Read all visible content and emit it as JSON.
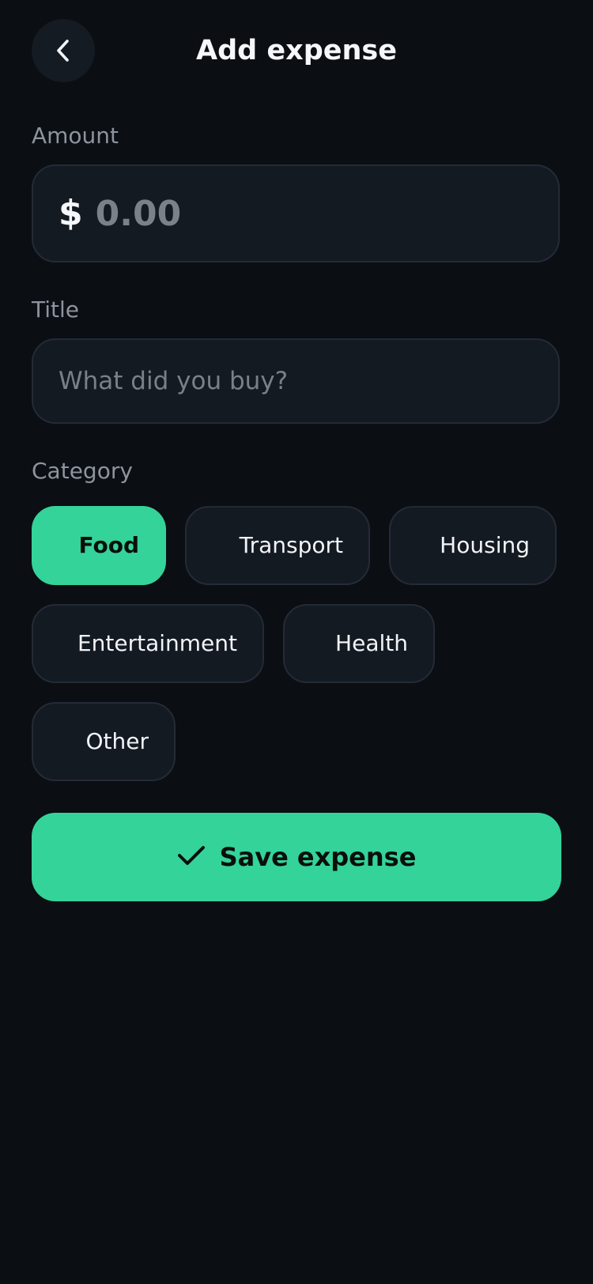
{
  "header": {
    "title": "Add expense",
    "back_icon": "chevron-left-icon"
  },
  "amount": {
    "label": "Amount",
    "currency": "$",
    "placeholder": "0.00",
    "value": ""
  },
  "title_field": {
    "label": "Title",
    "placeholder": "What did you buy?",
    "value": ""
  },
  "category": {
    "label": "Category",
    "selected": "Food",
    "options": [
      "Food",
      "Transport",
      "Housing",
      "Entertainment",
      "Health",
      "Other"
    ]
  },
  "save": {
    "label": "Save expense",
    "icon": "check-icon"
  },
  "colors": {
    "background": "#0b0e13",
    "surface": "#141a22",
    "accent": "#34d399",
    "muted_text": "#8d949e"
  }
}
